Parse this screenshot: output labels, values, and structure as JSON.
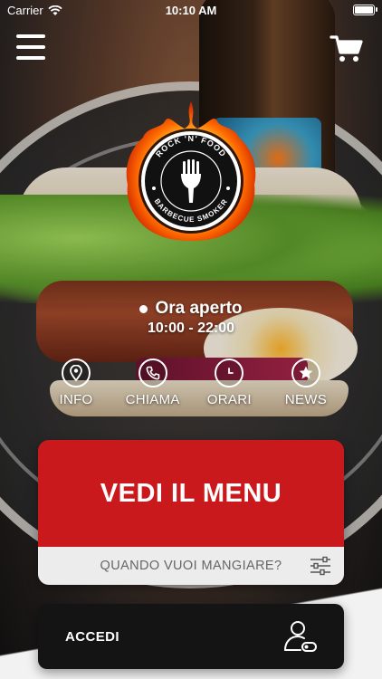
{
  "status_bar": {
    "carrier": "Carrier",
    "time": "10:10 AM"
  },
  "header": {
    "menu_icon": "hamburger-menu-icon",
    "cart_icon": "shopping-cart-icon"
  },
  "logo": {
    "top_text": "ROCK 'N' FOOD",
    "bottom_text": "BARBECUE SMOKER"
  },
  "open_status": {
    "label": "Ora aperto",
    "hours": "10:00 - 22:00"
  },
  "actions": [
    {
      "label": "INFO",
      "icon": "location-pin-icon"
    },
    {
      "label": "CHIAMA",
      "icon": "phone-icon"
    },
    {
      "label": "ORARI",
      "icon": "clock-icon"
    },
    {
      "label": "NEWS",
      "icon": "star-icon"
    }
  ],
  "menu_card": {
    "button_label": "VEDI IL MENU",
    "when_label": "QUANDO VUOI MANGIARE?",
    "filter_icon": "sliders-icon"
  },
  "login": {
    "label": "ACCEDI",
    "icon": "user-login-icon"
  },
  "colors": {
    "accent_red": "#c9191d",
    "dark": "#141414",
    "light_gray": "#ececec"
  }
}
